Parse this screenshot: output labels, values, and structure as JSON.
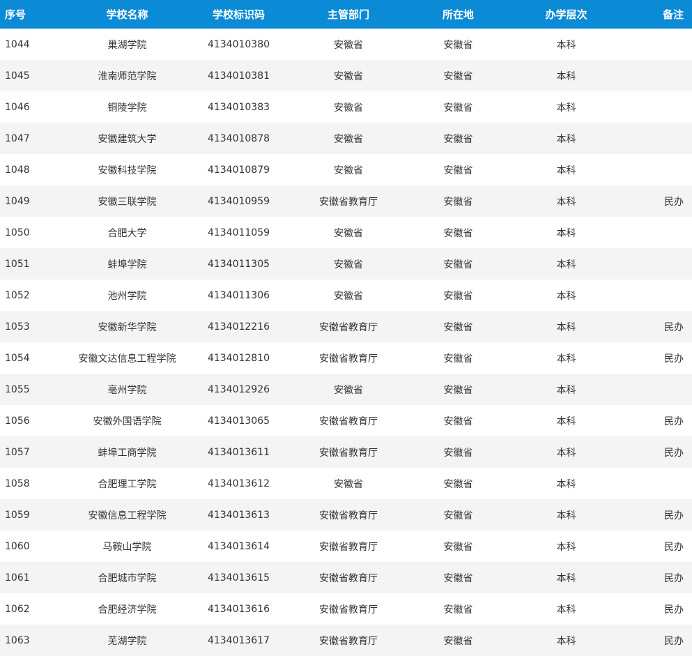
{
  "table": {
    "headers": [
      "序号",
      "学校名称",
      "学校标识码",
      "主管部门",
      "所在地",
      "办学层次",
      "备注"
    ],
    "rows": [
      [
        "1044",
        "巢湖学院",
        "4134010380",
        "安徽省",
        "安徽省",
        "本科",
        ""
      ],
      [
        "1045",
        "淮南师范学院",
        "4134010381",
        "安徽省",
        "安徽省",
        "本科",
        ""
      ],
      [
        "1046",
        "铜陵学院",
        "4134010383",
        "安徽省",
        "安徽省",
        "本科",
        ""
      ],
      [
        "1047",
        "安徽建筑大学",
        "4134010878",
        "安徽省",
        "安徽省",
        "本科",
        ""
      ],
      [
        "1048",
        "安徽科技学院",
        "4134010879",
        "安徽省",
        "安徽省",
        "本科",
        ""
      ],
      [
        "1049",
        "安徽三联学院",
        "4134010959",
        "安徽省教育厅",
        "安徽省",
        "本科",
        "民办"
      ],
      [
        "1050",
        "合肥大学",
        "4134011059",
        "安徽省",
        "安徽省",
        "本科",
        ""
      ],
      [
        "1051",
        "蚌埠学院",
        "4134011305",
        "安徽省",
        "安徽省",
        "本科",
        ""
      ],
      [
        "1052",
        "池州学院",
        "4134011306",
        "安徽省",
        "安徽省",
        "本科",
        ""
      ],
      [
        "1053",
        "安徽新华学院",
        "4134012216",
        "安徽省教育厅",
        "安徽省",
        "本科",
        "民办"
      ],
      [
        "1054",
        "安徽文达信息工程学院",
        "4134012810",
        "安徽省教育厅",
        "安徽省",
        "本科",
        "民办"
      ],
      [
        "1055",
        "亳州学院",
        "4134012926",
        "安徽省",
        "安徽省",
        "本科",
        ""
      ],
      [
        "1056",
        "安徽外国语学院",
        "4134013065",
        "安徽省教育厅",
        "安徽省",
        "本科",
        "民办"
      ],
      [
        "1057",
        "蚌埠工商学院",
        "4134013611",
        "安徽省教育厅",
        "安徽省",
        "本科",
        "民办"
      ],
      [
        "1058",
        "合肥理工学院",
        "4134013612",
        "安徽省",
        "安徽省",
        "本科",
        ""
      ],
      [
        "1059",
        "安徽信息工程学院",
        "4134013613",
        "安徽省教育厅",
        "安徽省",
        "本科",
        "民办"
      ],
      [
        "1060",
        "马鞍山学院",
        "4134013614",
        "安徽省教育厅",
        "安徽省",
        "本科",
        "民办"
      ],
      [
        "1061",
        "合肥城市学院",
        "4134013615",
        "安徽省教育厅",
        "安徽省",
        "本科",
        "民办"
      ],
      [
        "1062",
        "合肥经济学院",
        "4134013616",
        "安徽省教育厅",
        "安徽省",
        "本科",
        "民办"
      ],
      [
        "1063",
        "芜湖学院",
        "4134013617",
        "安徽省教育厅",
        "安徽省",
        "本科",
        "民办"
      ]
    ]
  },
  "colors": {
    "header_bg": "#0b8ad6",
    "header_text": "#ffffff",
    "row_alt_bg": "#f4f4f4",
    "text": "#333333"
  }
}
